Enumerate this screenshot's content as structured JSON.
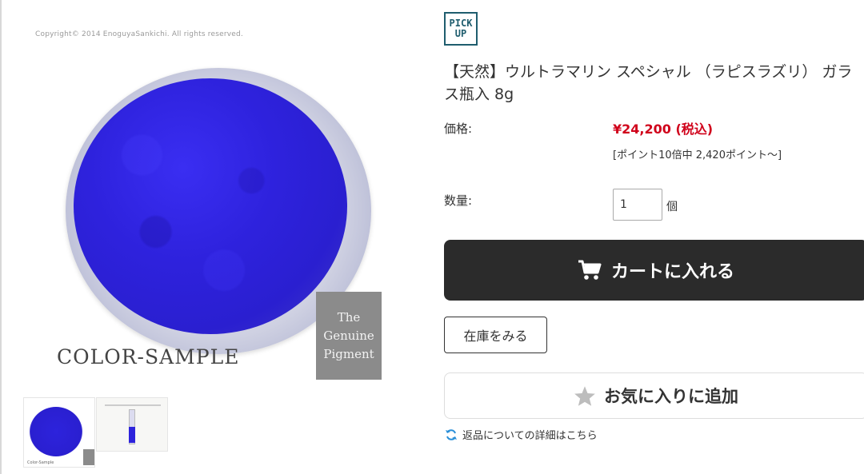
{
  "product_image": {
    "copyright": "Copyright© 2014 EnoguyaSankichi. All rights reserved.",
    "sample_label": "COLOR-SAMPLE",
    "badge_lines": [
      "The",
      "Genuine",
      "Pigment"
    ]
  },
  "thumbnails": [
    {
      "label": "Color-Sample",
      "icon": "pigment-dish"
    },
    {
      "icon": "pigment-vial"
    }
  ],
  "pickup_badge": [
    "PICK",
    "UP"
  ],
  "product": {
    "title": "【天然】ウルトラマリン スペシャル （ラピスラズリ） ガラス瓶入 8g",
    "price_label": "価格:",
    "price": "¥24,200 (税込)",
    "points": "[ポイント10倍中 2,420ポイント〜]",
    "qty_label": "数量:",
    "qty_value": "1",
    "qty_unit": "個"
  },
  "actions": {
    "cart": "カートに入れる",
    "stock": "在庫をみる",
    "favorite": "お気に入りに追加",
    "return_link": "返品についての詳細はこちら"
  },
  "colors": {
    "price": "#d0021b",
    "cart_bg": "#2b2b2b",
    "pickup": "#1f5d6e",
    "pigment": "#2a1fd0"
  }
}
